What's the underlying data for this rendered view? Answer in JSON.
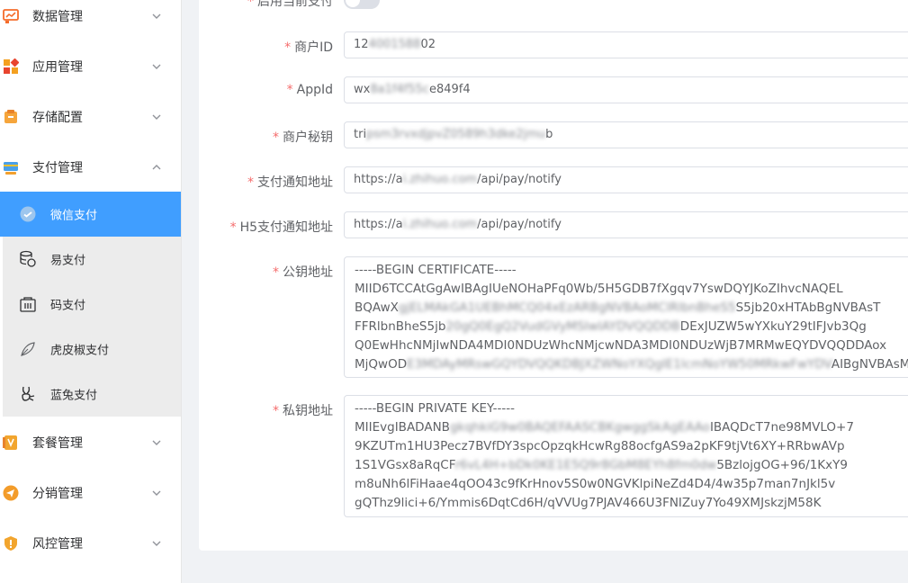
{
  "sidebar": {
    "menu": [
      {
        "label": "数据管理",
        "icon": "data-chart-icon"
      },
      {
        "label": "应用管理",
        "icon": "apps-icon"
      },
      {
        "label": "存储配置",
        "icon": "storage-icon"
      },
      {
        "label": "支付管理",
        "icon": "payment-icon"
      },
      {
        "label": "套餐管理",
        "icon": "package-icon"
      },
      {
        "label": "分销管理",
        "icon": "distribution-icon"
      },
      {
        "label": "风控管理",
        "icon": "risk-shield-icon"
      }
    ],
    "submenu": [
      {
        "label": "微信支付",
        "icon": "wechat-icon",
        "active": true
      },
      {
        "label": "易支付",
        "icon": "database-coins-icon"
      },
      {
        "label": "码支付",
        "icon": "qrcode-bag-icon"
      },
      {
        "label": "虎皮椒支付",
        "icon": "pepper-leaf-icon"
      },
      {
        "label": "蓝兔支付",
        "icon": "rabbit-icon"
      }
    ]
  },
  "form": {
    "enable_label": "启用当前支付",
    "enable_value": false,
    "merchant_id": {
      "label": "商户ID",
      "value_visible_start": "12",
      "value_blurred": "4001588",
      "value_visible_end": "02"
    },
    "app_id": {
      "label": "AppId",
      "value_visible_start": "wx",
      "value_blurred": "8a1f4f55c",
      "value_visible_end": "e849f4"
    },
    "merchant_key": {
      "label": "商户秘钥",
      "value_visible_start": "tri",
      "value_blurred": "psm3rvxdjpvZ0589h3dke2jmu",
      "value_visible_end": "b"
    },
    "notify_url": {
      "label": "支付通知地址",
      "value_visible_start": "https://a",
      "value_blurred": "i.zhihuo.com",
      "value_visible_end": "/api/pay/notify"
    },
    "h5_notify_url": {
      "label": "H5支付通知地址",
      "value_visible_start": "https://a",
      "value_blurred": "i.zhihuo.com",
      "value_visible_end": "/api/pay/notify"
    },
    "public_key": {
      "label": "公钥地址",
      "lines": [
        {
          "text": "-----BEGIN CERTIFICATE-----"
        },
        {
          "text": "MIID6TCCAtGgAwIBAgIUeNOHaPFq0Wb/5H5GDB7fXgqv7YswDQYJKoZIhvcNAQEL"
        },
        {
          "text": "BQAwX",
          "blur": "gjELMAkGA1UEBhMCQ04xEzARBgNVBAoMClRlbnBheS5",
          "end": "S5jb20xHTAbBgNVBAsT"
        },
        {
          "text": "FFRlbnBheS5jb",
          "blur": "20gQ0EgQ2VudGVyMSIwIAYDVQQDDB",
          "end": "DExJUZW5wYXkuY29tIFJvb3Qg"
        },
        {
          "text": "Q0EwHhcNMjIwNDA4MDI0NDUzWhcNMjcwNDA3MDI0NDUzWjB7MRMwEQYDVQQDDAox"
        },
        {
          "text": "MjQwOD",
          "blur": "E3MDAyMRswGQYDVQQKDBJXZWNoYXQgIE1lcmNoYW50MRkwFwYDV",
          "end": "AIBgNVBAsM"
        }
      ]
    },
    "private_key": {
      "label": "私钥地址",
      "lines": [
        {
          "text": "-----BEGIN PRIVATE KEY-----"
        },
        {
          "text": "MIIEvgIBADANB",
          "blur": "gkqhkiG9w0BAQEFAASCBKgwggSkAgEAAo",
          "end": "IBAQDcT7ne98MVLO+7"
        },
        {
          "text": "9KZUTm1HU3Pecz7BVfDY3spcOpzqkHcwRg88ocfgAS9a2pKF9tjVt6XY+RRbwAVp"
        },
        {
          "text": "1S1VGsx8aRqCF",
          "blur": "r6vL4H+bDk0KE1E5Q9r8GbM8EYh8fm0dw",
          "end": "5BzlojgOG+96/1KxY9"
        },
        {
          "text": "m8uNh6lFiHaae4qOO43c9fKrHnov5S0w0NGVKlpiNeZd4D4/4w35p7man7nJkl5v"
        },
        {
          "text": "gQThz9lici+6/Ymmis6DqtCd6H/qVVUg7PJAV466U3FNIZuy7Yo49XMJskzjM58K"
        }
      ]
    }
  }
}
